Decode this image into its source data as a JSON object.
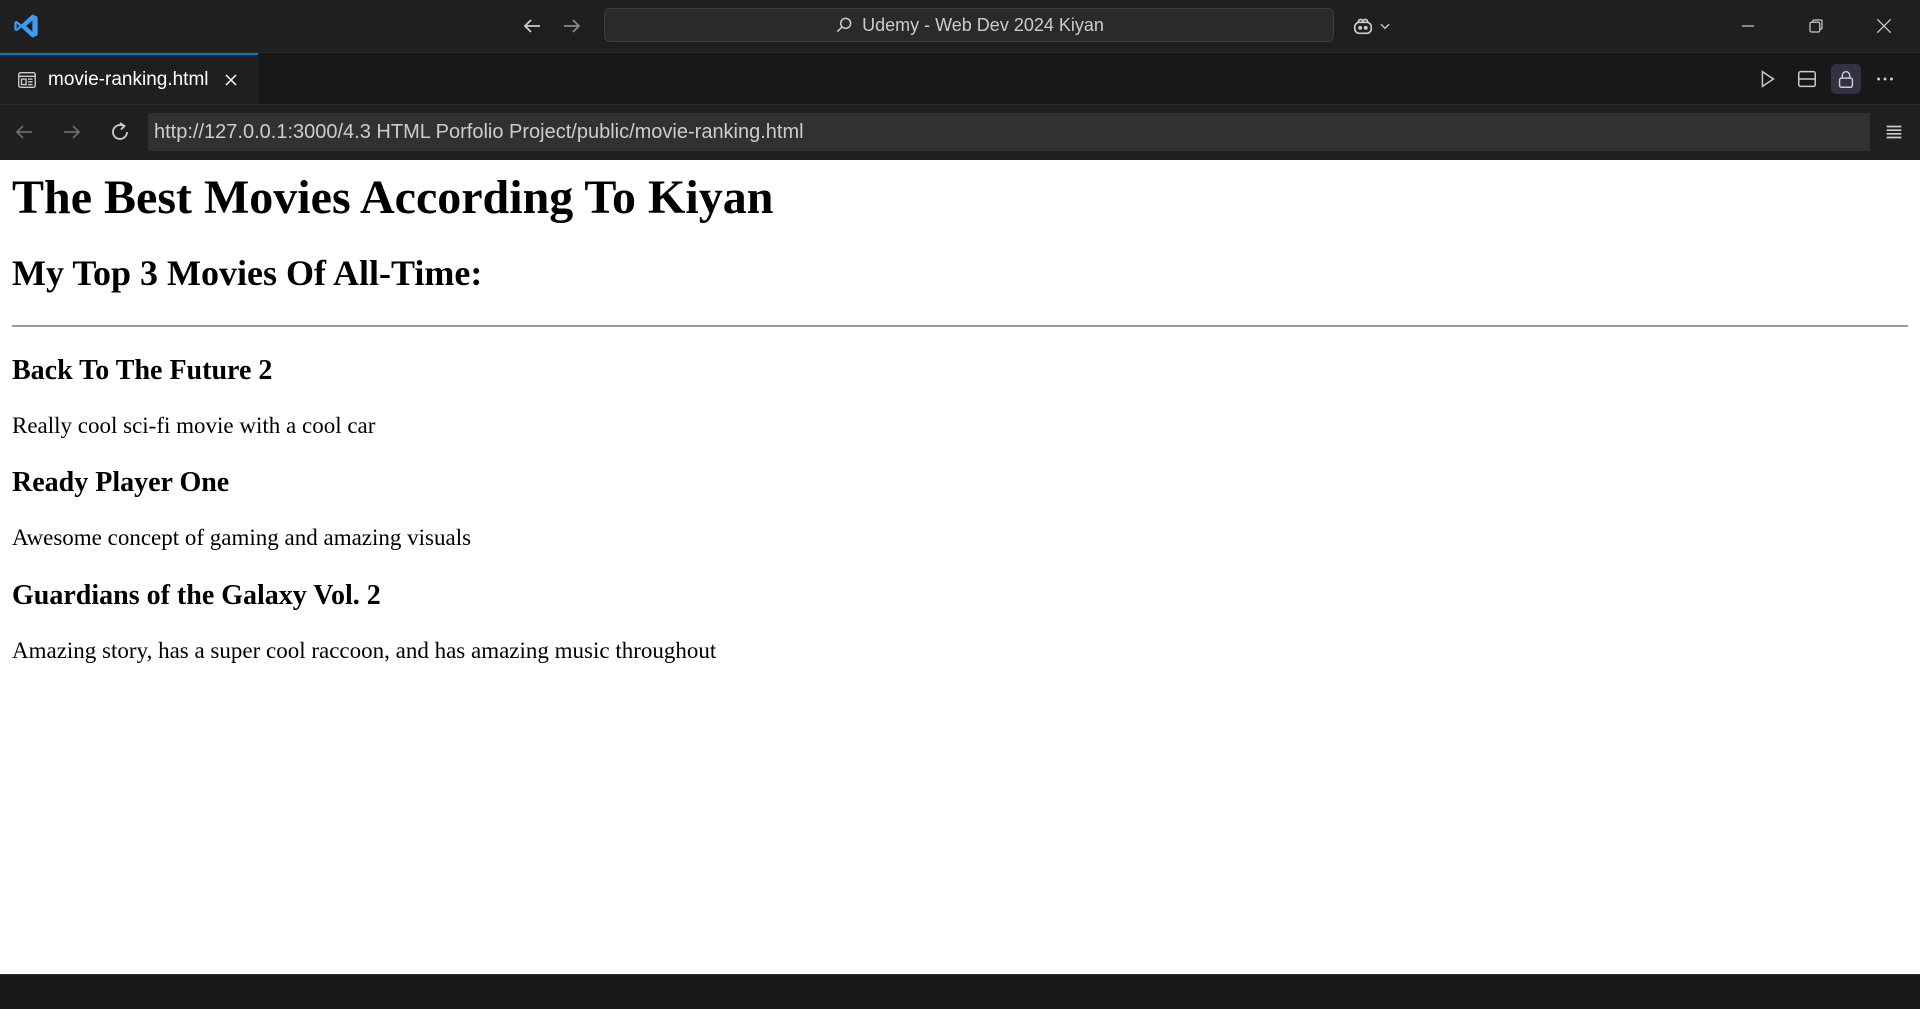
{
  "window": {
    "command_center_text": "Udemy - Web Dev 2024 Kiyan"
  },
  "tab": {
    "label": "movie-ranking.html"
  },
  "browser": {
    "url": "http://127.0.0.1:3000/4.3 HTML Porfolio Project/public/movie-ranking.html"
  },
  "page": {
    "title": "The Best Movies According To Kiyan",
    "subtitle": "My Top 3 Movies Of All-Time:",
    "movies": [
      {
        "name": "Back To The Future 2",
        "description": "Really cool sci-fi movie with a cool car"
      },
      {
        "name": "Ready Player One",
        "description": "Awesome concept of gaming and amazing visuals"
      },
      {
        "name": "Guardians of the Galaxy Vol. 2",
        "description": "Amazing story, has a super cool raccoon, and has amazing music throughout"
      }
    ]
  },
  "colors": {
    "accent": "#0078d4",
    "chrome_bg": "#1f1f1f",
    "page_bg": "#ffffff"
  },
  "icons": [
    "vscode-logo",
    "arrow-left-icon",
    "arrow-right-icon",
    "search-icon",
    "copilot-icon",
    "chevron-down-icon",
    "minimize-icon",
    "restore-icon",
    "close-icon",
    "preview-icon",
    "run-icon",
    "split-editor-icon",
    "lock-icon",
    "more-icon",
    "reload-icon",
    "menu-icon"
  ]
}
